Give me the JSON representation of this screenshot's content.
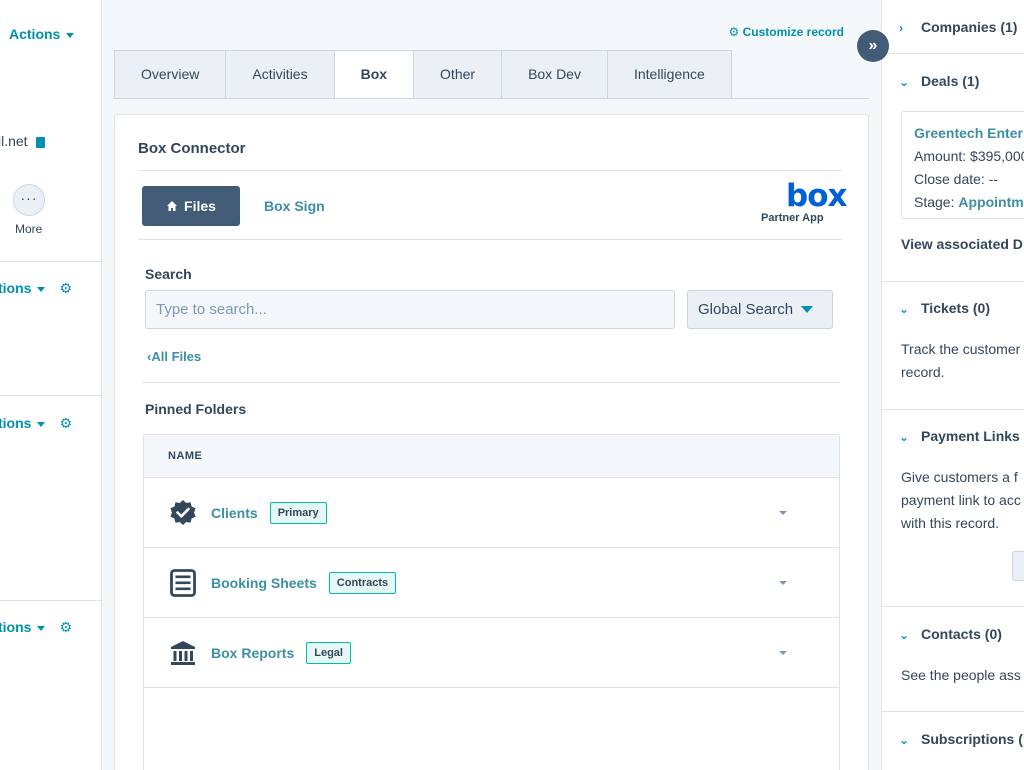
{
  "left": {
    "actions_label": "Actions",
    "email_fragment": "il.net",
    "more_glyph": "···",
    "more_label": "More",
    "sections": [
      {
        "label": "tions"
      },
      {
        "label": "tions"
      },
      {
        "label": "tions"
      }
    ]
  },
  "header": {
    "customize_label": "Customize record"
  },
  "tabs": [
    {
      "label": "Overview",
      "active": false
    },
    {
      "label": "Activities",
      "active": false
    },
    {
      "label": "Box",
      "active": true
    },
    {
      "label": "Other",
      "active": false
    },
    {
      "label": "Box Dev",
      "active": false
    },
    {
      "label": "Intelligence",
      "active": false
    }
  ],
  "box_card": {
    "title": "Box Connector",
    "files_label": "Files",
    "box_sign_label": "Box Sign",
    "logo_text": "box",
    "partner_label": "Partner App",
    "search_label": "Search",
    "search_placeholder": "Type to search...",
    "global_search_label": "Global Search",
    "all_files_label": "All Files",
    "pinned_title": "Pinned Folders",
    "table_header": "NAME",
    "rows": [
      {
        "name": "Clients",
        "badge": "Primary",
        "icon": "verified-badge-icon"
      },
      {
        "name": "Booking Sheets",
        "badge": "Contracts",
        "icon": "list-document-icon"
      },
      {
        "name": "Box Reports",
        "badge": "Legal",
        "icon": "bank-building-icon"
      }
    ]
  },
  "expand_glyph": "»",
  "right": {
    "companies_label": "Companies (1)",
    "deals_label": "Deals (1)",
    "deal": {
      "name": "Greentech Enter",
      "amount": "Amount: $395,000",
      "close": "Close date: --",
      "stage_label": "Stage: ",
      "stage_value": "Appointm"
    },
    "view_associated": "View associated D",
    "tickets_label": "Tickets (0)",
    "tickets_text_1": "Track the customer",
    "tickets_text_2": "record.",
    "payment_label": "Payment Links",
    "payment_text_1": "Give customers a f",
    "payment_text_2": "payment link to acc",
    "payment_text_3": "with this record.",
    "contacts_label": "Contacts (0)",
    "contacts_text": "See the people ass",
    "subscriptions_label": "Subscriptions ("
  },
  "colors": {
    "accent": "#0091ae",
    "link": "#3d8fa3",
    "primary_button": "#425b76",
    "box_blue": "#0061d5",
    "badge_border": "#00bda5"
  }
}
